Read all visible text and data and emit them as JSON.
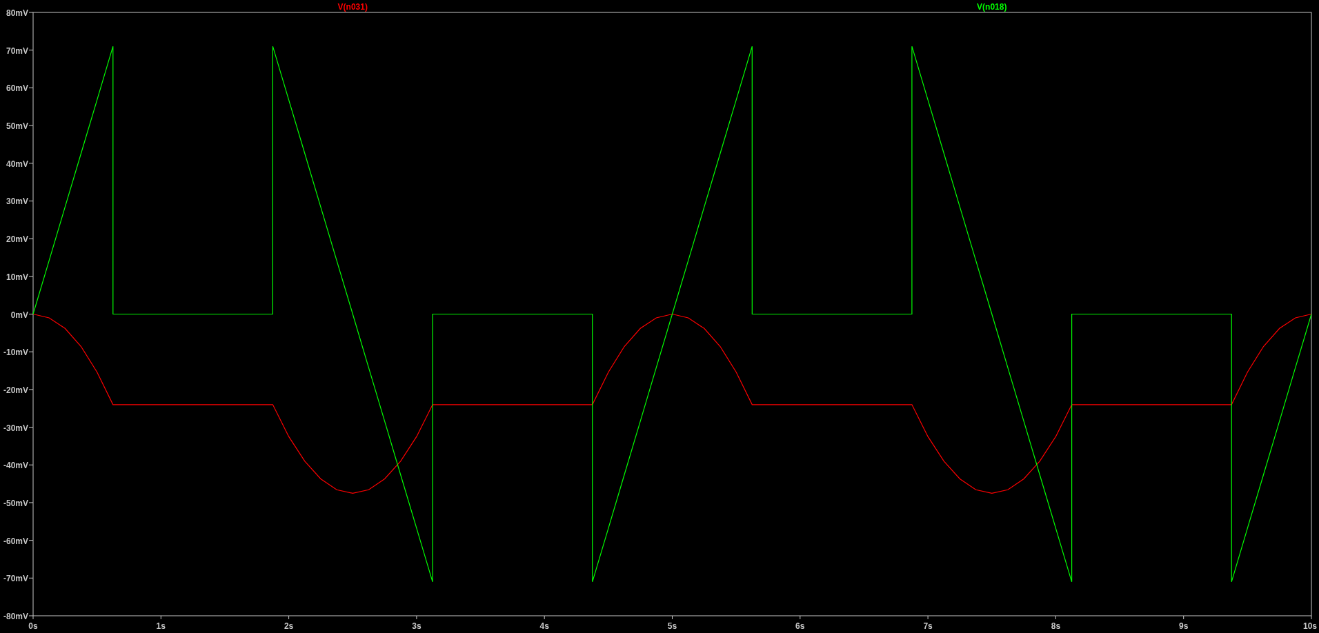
{
  "chart_data": {
    "type": "line",
    "xlim": [
      0,
      10
    ],
    "ylim": [
      -80,
      80
    ],
    "xticks": [
      {
        "value": 0,
        "label": "0s"
      },
      {
        "value": 1,
        "label": "1s"
      },
      {
        "value": 2,
        "label": "2s"
      },
      {
        "value": 3,
        "label": "3s"
      },
      {
        "value": 4,
        "label": "4s"
      },
      {
        "value": 5,
        "label": "5s"
      },
      {
        "value": 6,
        "label": "6s"
      },
      {
        "value": 7,
        "label": "7s"
      },
      {
        "value": 8,
        "label": "8s"
      },
      {
        "value": 9,
        "label": "9s"
      },
      {
        "value": 10,
        "label": "10s"
      }
    ],
    "yticks": [
      {
        "value": 80,
        "label": "80mV"
      },
      {
        "value": 70,
        "label": "70mV"
      },
      {
        "value": 60,
        "label": "60mV"
      },
      {
        "value": 50,
        "label": "50mV"
      },
      {
        "value": 40,
        "label": "40mV"
      },
      {
        "value": 30,
        "label": "30mV"
      },
      {
        "value": 20,
        "label": "20mV"
      },
      {
        "value": 10,
        "label": "10mV"
      },
      {
        "value": 0,
        "label": "0mV"
      },
      {
        "value": -10,
        "label": "-10mV"
      },
      {
        "value": -20,
        "label": "-20mV"
      },
      {
        "value": -30,
        "label": "-30mV"
      },
      {
        "value": -40,
        "label": "-40mV"
      },
      {
        "value": -50,
        "label": "-50mV"
      },
      {
        "value": -60,
        "label": "-60mV"
      },
      {
        "value": -70,
        "label": "-70mV"
      },
      {
        "value": -80,
        "label": "-80mV"
      }
    ],
    "x": [
      0,
      0.125,
      0.25,
      0.375,
      0.5,
      0.625,
      0.625,
      0.75,
      0.875,
      1,
      1.125,
      1.25,
      1.375,
      1.5,
      1.625,
      1.75,
      1.875,
      1.875,
      2,
      2.125,
      2.25,
      2.375,
      2.5,
      2.625,
      2.75,
      2.875,
      3,
      3.125,
      3.125,
      3.25,
      3.375,
      3.5,
      3.625,
      3.75,
      3.875,
      4,
      4.125,
      4.25,
      4.375,
      4.375,
      4.5,
      4.625,
      4.75,
      4.875,
      5,
      5.125,
      5.25,
      5.375,
      5.5,
      5.625,
      5.625,
      5.75,
      5.875,
      6,
      6.125,
      6.25,
      6.375,
      6.5,
      6.625,
      6.75,
      6.875,
      6.875,
      7,
      7.125,
      7.25,
      7.375,
      7.5,
      7.625,
      7.75,
      7.875,
      8,
      8.125,
      8.125,
      8.25,
      8.375,
      8.5,
      8.625,
      8.75,
      8.875,
      9,
      9.125,
      9.25,
      9.375,
      9.375,
      9.5,
      9.625,
      9.75,
      9.875,
      10
    ],
    "series": [
      {
        "name": "V(n031)",
        "color": "#ff0000",
        "values": [
          0,
          -1,
          -3.8,
          -8.6,
          -15.4,
          -24,
          -24,
          -24,
          -24,
          -24,
          -24,
          -24,
          -24,
          -24,
          -24,
          -24,
          -24,
          -24,
          -32.5,
          -39,
          -43.7,
          -46.6,
          -47.5,
          -46.6,
          -43.7,
          -39,
          -32.5,
          -24,
          -24,
          -24,
          -24,
          -24,
          -24,
          -24,
          -24,
          -24,
          -24,
          -24,
          -24,
          -24,
          -15.4,
          -8.6,
          -3.8,
          -1,
          0,
          -1,
          -3.8,
          -8.6,
          -15.4,
          -24,
          -24,
          -24,
          -24,
          -24,
          -24,
          -24,
          -24,
          -24,
          -24,
          -24,
          -24,
          -24,
          -32.5,
          -39,
          -43.7,
          -46.6,
          -47.5,
          -46.6,
          -43.7,
          -39,
          -32.5,
          -24,
          -24,
          -24,
          -24,
          -24,
          -24,
          -24,
          -24,
          -24,
          -24,
          -24,
          -24,
          -24,
          -15.4,
          -8.6,
          -3.8,
          -1,
          0
        ]
      },
      {
        "name": "V(n018)",
        "color": "#00ff00",
        "values": [
          0,
          14.2,
          28.4,
          42.6,
          56.8,
          71,
          0,
          0,
          0,
          0,
          0,
          0,
          0,
          0,
          0,
          0,
          0,
          71,
          56.8,
          42.6,
          28.4,
          14.2,
          0,
          -14.2,
          -28.4,
          -42.6,
          -56.8,
          -71,
          0,
          0,
          0,
          0,
          0,
          0,
          0,
          0,
          0,
          0,
          0,
          -71,
          -56.8,
          -42.6,
          -28.4,
          -14.2,
          0,
          14.2,
          28.4,
          42.6,
          56.8,
          71,
          0,
          0,
          0,
          0,
          0,
          0,
          0,
          0,
          0,
          0,
          0,
          71,
          56.8,
          42.6,
          28.4,
          14.2,
          0,
          -14.2,
          -28.4,
          -42.6,
          -56.8,
          -71,
          0,
          0,
          0,
          0,
          0,
          0,
          0,
          0,
          0,
          0,
          0,
          -71,
          -56.8,
          -42.6,
          -28.4,
          -14.2,
          0
        ]
      }
    ]
  }
}
